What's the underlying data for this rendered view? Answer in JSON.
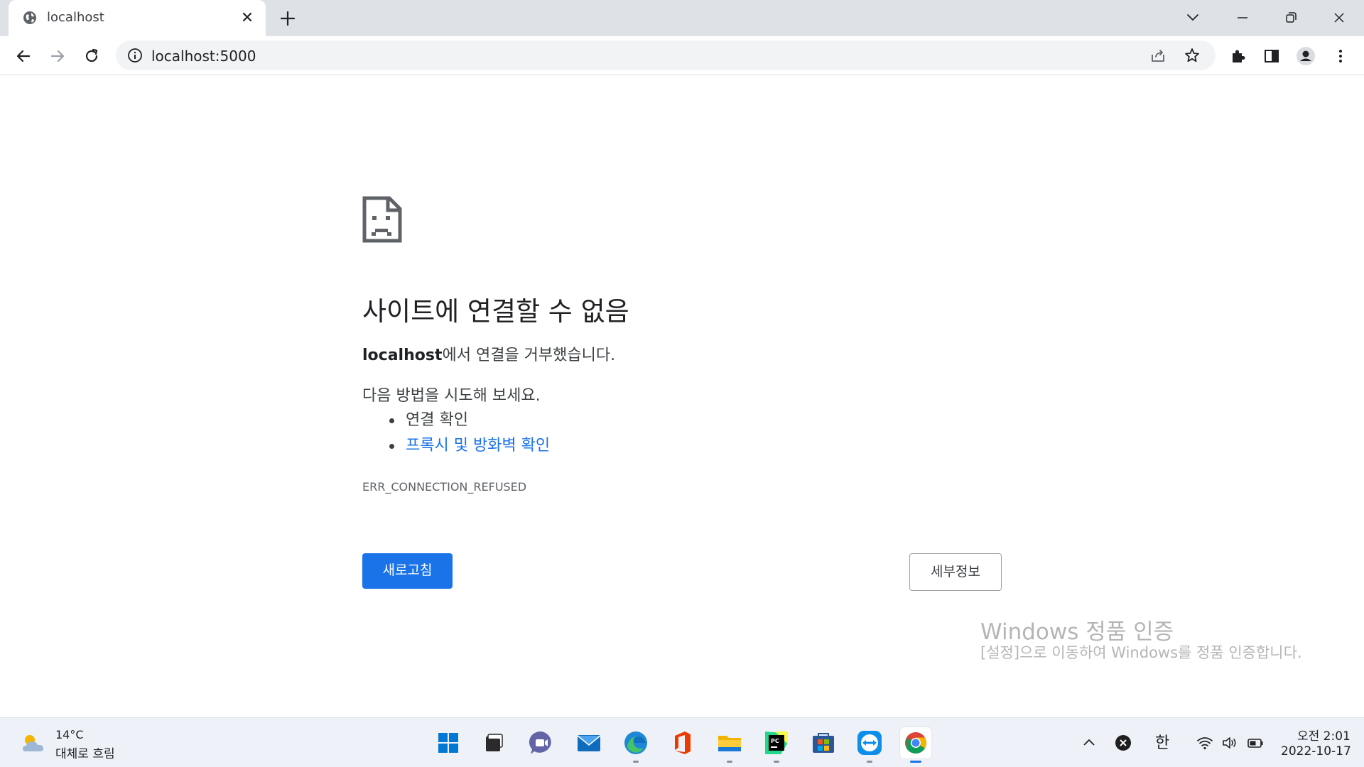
{
  "tab": {
    "title": "localhost"
  },
  "address_bar": {
    "url": "localhost:5000"
  },
  "error": {
    "title": "사이트에 연결할 수 없음",
    "host": "localhost",
    "desc_suffix": "에서 연결을 거부했습니다.",
    "try_text": "다음 방법을 시도해 보세요.",
    "suggestions": [
      "연결 확인",
      "프록시 및 방화벽 확인"
    ],
    "code": "ERR_CONNECTION_REFUSED",
    "reload_label": "새로고침",
    "details_label": "세부정보"
  },
  "watermark": {
    "title": "Windows 정품 인증",
    "body": "[설정]으로 이동하여 Windows를 정품 인증합니다."
  },
  "taskbar": {
    "weather_temp": "14°C",
    "weather_cond": "대체로 흐림",
    "apps": [
      "start-icon",
      "task-view-icon",
      "chat-icon",
      "mail-icon",
      "edge-icon",
      "office-icon",
      "file-explorer-icon",
      "pycharm-icon",
      "store-icon",
      "teamviewer-icon",
      "chrome-icon"
    ],
    "ime": "한",
    "time": "오전 2:01",
    "date": "2022-10-17"
  },
  "colors": {
    "accent": "#1a73e8",
    "tab_strip": "#dee1e6",
    "omnibox": "#f1f3f4"
  }
}
